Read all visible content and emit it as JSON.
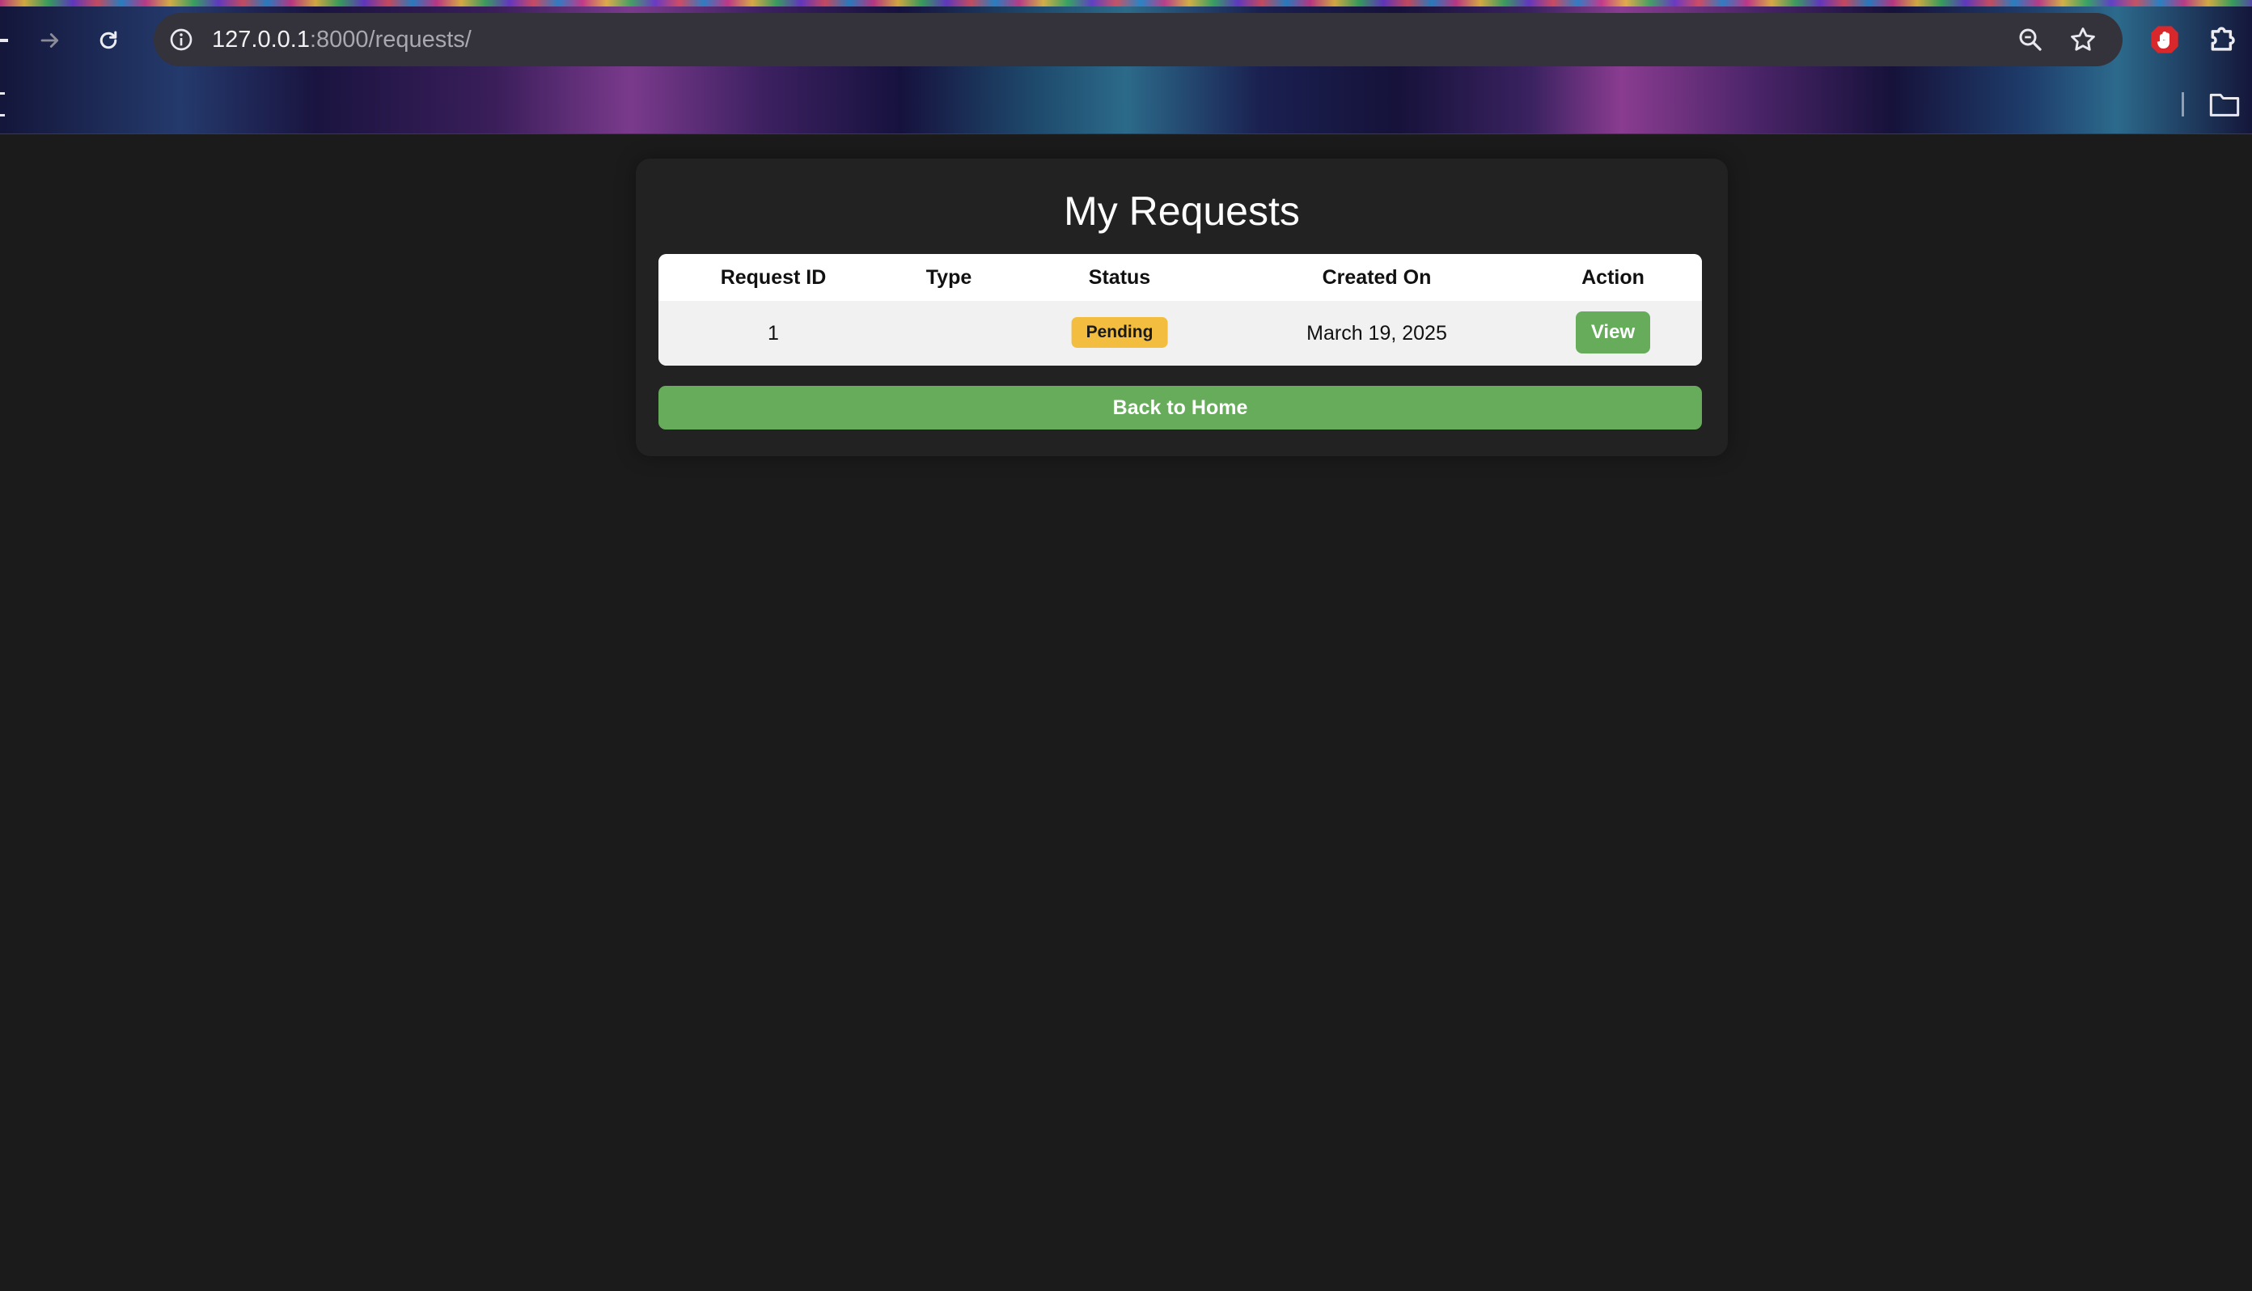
{
  "browser": {
    "url_host": "127.0.0.1",
    "url_rest": ":8000/requests/"
  },
  "page": {
    "title": "My Requests",
    "table": {
      "headers": [
        "Request ID",
        "Type",
        "Status",
        "Created On",
        "Action"
      ],
      "rows": [
        {
          "request_id": "1",
          "type": "",
          "status": "Pending",
          "created_on": "March 19, 2025",
          "action": "View"
        }
      ]
    },
    "back_button": "Back to Home"
  },
  "colors": {
    "page_background": "#1b1b1b",
    "card_background": "#222222",
    "accent_green": "#66ac5b",
    "pending_badge": "#f3be3f"
  }
}
